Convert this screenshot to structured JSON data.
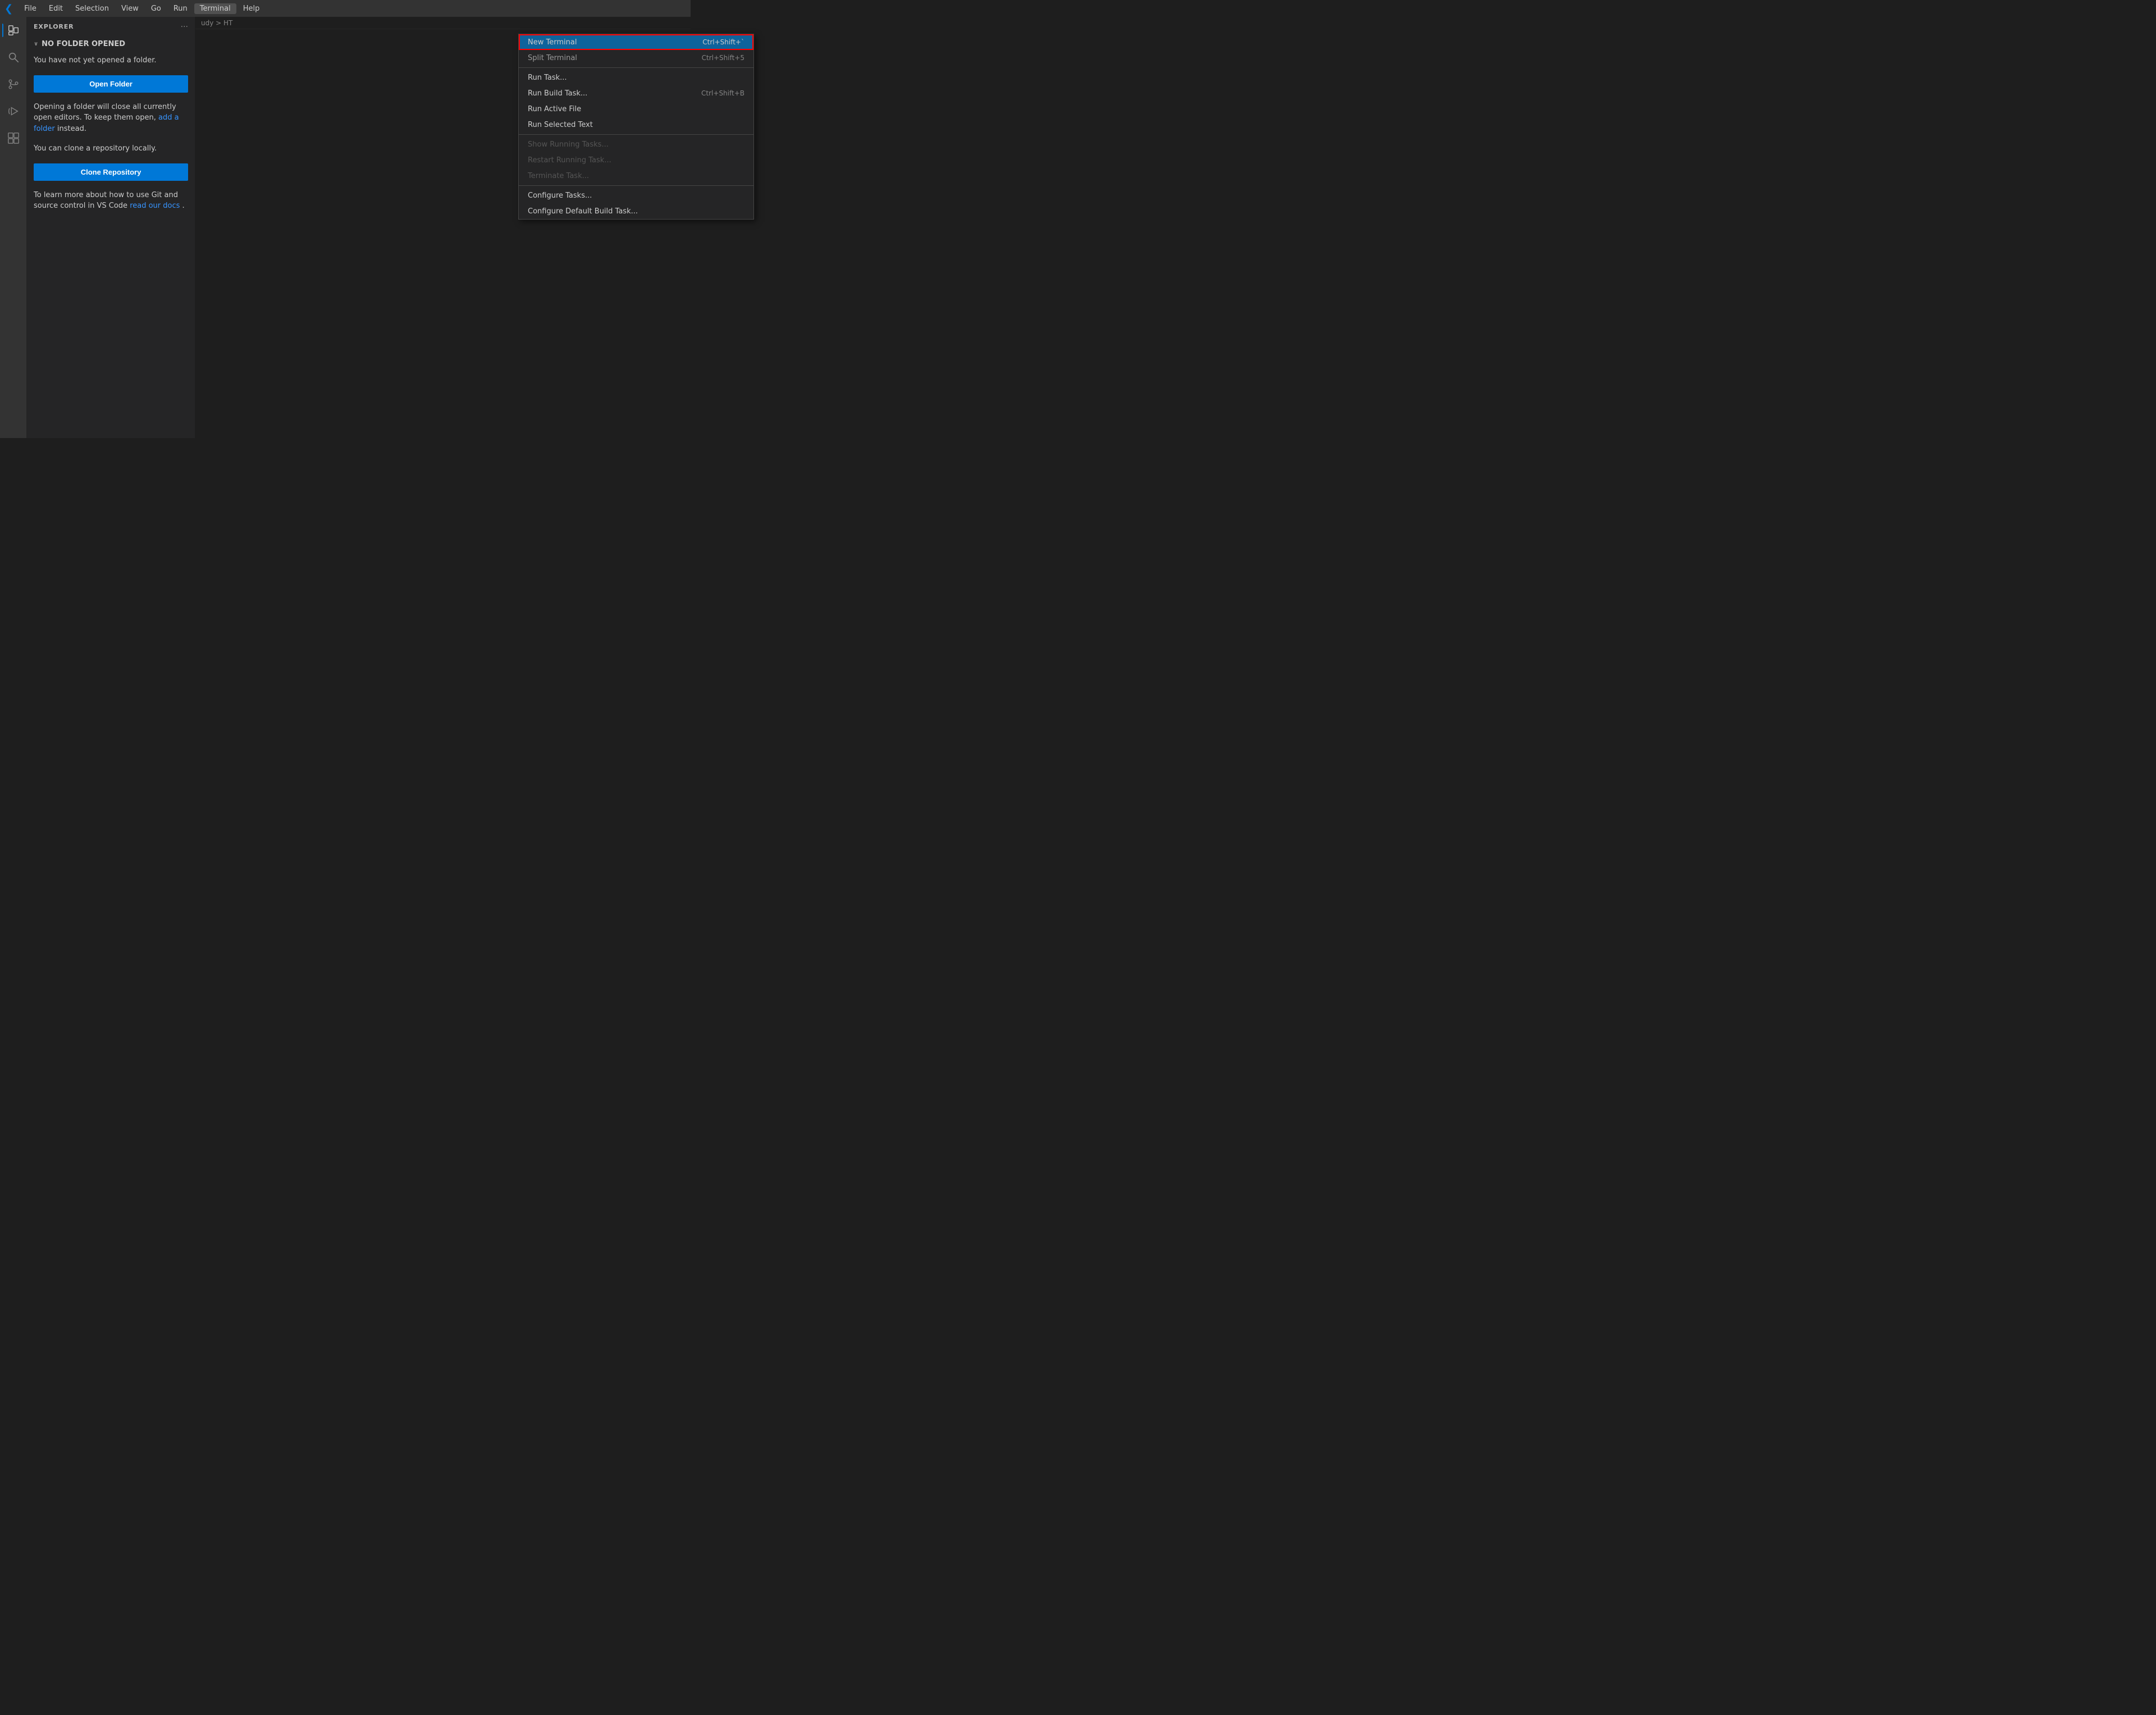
{
  "menubar": {
    "logo": "◀",
    "items": [
      {
        "label": "File",
        "id": "file"
      },
      {
        "label": "Edit",
        "id": "edit"
      },
      {
        "label": "Selection",
        "id": "selection"
      },
      {
        "label": "View",
        "id": "view"
      },
      {
        "label": "Go",
        "id": "go"
      },
      {
        "label": "Run",
        "id": "run"
      },
      {
        "label": "Terminal",
        "id": "terminal",
        "active": true
      },
      {
        "label": "Help",
        "id": "help"
      }
    ]
  },
  "activity_bar": {
    "icons": [
      {
        "name": "explorer-icon",
        "symbol": "⧉",
        "active": true
      },
      {
        "name": "search-icon",
        "symbol": "🔍",
        "active": false
      },
      {
        "name": "source-control-icon",
        "symbol": "⑂",
        "active": false
      },
      {
        "name": "run-icon",
        "symbol": "▷",
        "active": false
      },
      {
        "name": "extensions-icon",
        "symbol": "⊞",
        "active": false
      }
    ]
  },
  "sidebar": {
    "title": "EXPLORER",
    "dots_icon": "···",
    "folder_section": {
      "chevron": "∨",
      "heading": "NO FOLDER OPENED"
    },
    "text1": "You have not yet opened a folder.",
    "open_folder_btn": "Open Folder",
    "text2": "Opening a folder will close all currently open editors. To keep them open,",
    "link1": "add a folder",
    "text2b": "instead.",
    "text3": "You can clone a repository locally.",
    "clone_btn": "Clone Repository",
    "text4": "To learn more about how to use Git and source control in VS Code",
    "link2": "read our docs",
    "text4b": "."
  },
  "breadcrumb": {
    "path": "udy > HT"
  },
  "terminal_menu": {
    "items": [
      {
        "id": "new-terminal",
        "label": "New Terminal",
        "shortcut": "Ctrl+Shift+`",
        "highlighted": true,
        "disabled": false
      },
      {
        "id": "split-terminal",
        "label": "Split Terminal",
        "shortcut": "Ctrl+Shift+5",
        "highlighted": false,
        "disabled": false,
        "faded": true
      },
      {
        "id": "separator1",
        "type": "separator"
      },
      {
        "id": "run-task",
        "label": "Run Task...",
        "shortcut": "",
        "highlighted": false,
        "disabled": false
      },
      {
        "id": "run-build-task",
        "label": "Run Build Task...",
        "shortcut": "Ctrl+Shift+B",
        "highlighted": false,
        "disabled": false
      },
      {
        "id": "run-active-file",
        "label": "Run Active File",
        "shortcut": "",
        "highlighted": false,
        "disabled": false
      },
      {
        "id": "run-selected-text",
        "label": "Run Selected Text",
        "shortcut": "",
        "highlighted": false,
        "disabled": false
      },
      {
        "id": "separator2",
        "type": "separator"
      },
      {
        "id": "show-running-tasks",
        "label": "Show Running Tasks...",
        "shortcut": "",
        "highlighted": false,
        "disabled": true
      },
      {
        "id": "restart-running-task",
        "label": "Restart Running Task...",
        "shortcut": "",
        "highlighted": false,
        "disabled": true
      },
      {
        "id": "terminate-task",
        "label": "Terminate Task...",
        "shortcut": "",
        "highlighted": false,
        "disabled": true
      },
      {
        "id": "separator3",
        "type": "separator"
      },
      {
        "id": "configure-tasks",
        "label": "Configure Tasks...",
        "shortcut": "",
        "highlighted": false,
        "disabled": false
      },
      {
        "id": "configure-default-build-task",
        "label": "Configure Default Build Task...",
        "shortcut": "",
        "highlighted": false,
        "disabled": false
      }
    ]
  }
}
